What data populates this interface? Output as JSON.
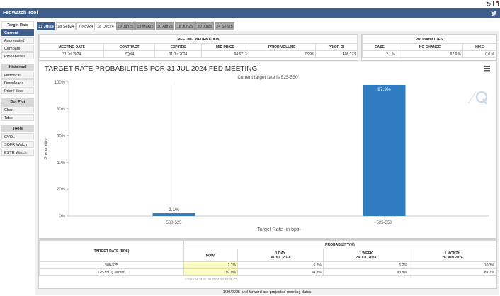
{
  "app": {
    "title": "FedWatch Tool"
  },
  "icons": {
    "refresh": "refresh-icon",
    "popout": "popout-icon",
    "twitter": "twitter-icon"
  },
  "sidebar": {
    "groups": [
      {
        "heading": "Target Rate",
        "items": [
          "Current",
          "Aggregated",
          "Compare",
          "Probabilities"
        ],
        "active": 0
      },
      {
        "heading": "Historical",
        "items": [
          "Historical",
          "Downloads",
          "Prior Hikes"
        ]
      },
      {
        "heading": "Dot Plot",
        "items": [
          "Chart",
          "Table"
        ]
      },
      {
        "heading": "Tools",
        "items": [
          "CVOL",
          "SOFR Watch",
          "ESTR Watch"
        ]
      }
    ]
  },
  "tabs": [
    {
      "label": "31 Jul24",
      "state": "active"
    },
    {
      "label": "18 Sep24",
      "state": "normal"
    },
    {
      "label": "7 Nov24",
      "state": "normal"
    },
    {
      "label": "18 Dec24",
      "state": "normal"
    },
    {
      "label": "29 Jan25",
      "state": "gray"
    },
    {
      "label": "19 Mar25",
      "state": "gray"
    },
    {
      "label": "30 Apr25",
      "state": "gray"
    },
    {
      "label": "18 Jun25",
      "state": "gray"
    },
    {
      "label": "30 Jul25",
      "state": "gray"
    },
    {
      "label": "24 Sep25",
      "state": "gray"
    }
  ],
  "meeting_info": {
    "title": "MEETING INFORMATION",
    "headers": [
      "MEETING DATE",
      "CONTRACT",
      "EXPIRES",
      "MID PRICE",
      "PRIOR VOLUME",
      "PRIOR OI"
    ],
    "values": [
      "31 Jul 2024",
      "ZQN4",
      "31 Jul 2024",
      "94.6713",
      "7,998",
      "408,173"
    ]
  },
  "probabilities": {
    "title": "PROBABILITIES",
    "headers": [
      "EASE",
      "NO CHANGE",
      "HIKE"
    ],
    "values": [
      "2.1 %",
      "97.9 %",
      "0.0 %"
    ]
  },
  "chart": {
    "menu_icon": "hamburger-menu-icon",
    "watermark_icon": "cme-q-logo-icon"
  },
  "chart_data": {
    "type": "bar",
    "title": "TARGET RATE PROBABILITIES FOR 31 JUL 2024 FED MEETING",
    "subtitle": "Current target rate is 525-550",
    "categories": [
      "500-525",
      "525-550"
    ],
    "values": [
      2.1,
      97.9
    ],
    "data_labels": [
      "2.1%",
      "97.9%"
    ],
    "xlabel": "Target Rate (in bps)",
    "ylabel": "Probability",
    "ylim": [
      0,
      100
    ],
    "yticks": [
      "0%",
      "20%",
      "40%",
      "60%",
      "80%",
      "100%"
    ],
    "bar_color": "#2f7dc0",
    "grid": false
  },
  "prob_table": {
    "col_head": "TARGET RATE (BPS)",
    "group_head": "PROBABILITY(%)",
    "now": {
      "label": "NOW",
      "mark": "*"
    },
    "cols": [
      {
        "label": "1 DAY",
        "date": "30 JUL 2024"
      },
      {
        "label": "1 WEEK",
        "date": "24 JUL 2024"
      },
      {
        "label": "1 MONTH",
        "date": "28 JUN 2024"
      }
    ],
    "rows": [
      {
        "rate": "500-525",
        "now": "2.1%",
        "d1": "5.2%",
        "w1": "6.2%",
        "m1": "10.3%"
      },
      {
        "rate": "525-550 (Current)",
        "now": "97.9%",
        "d1": "94.8%",
        "w1": "93.8%",
        "m1": "89.7%"
      }
    ],
    "note": "* Data as of 31 Jul 2024 12:38:35 CT"
  },
  "footnote": "1/29/2025 and forward are projected meeting dates"
}
